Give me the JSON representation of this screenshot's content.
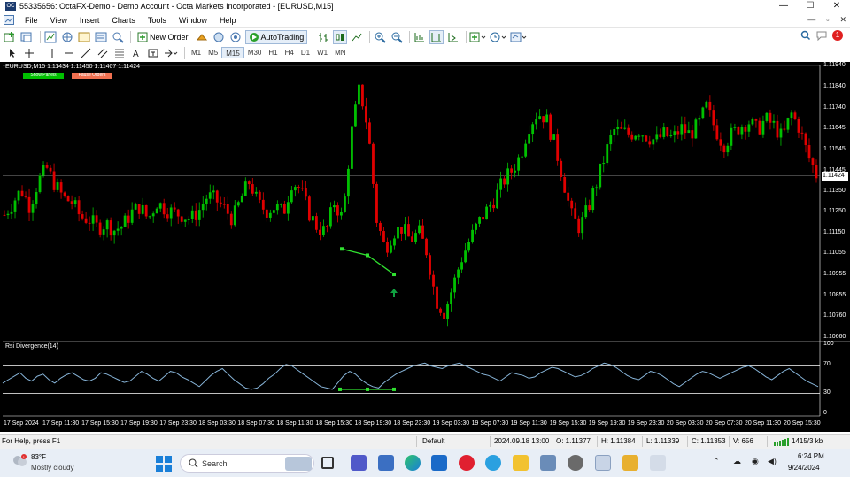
{
  "window": {
    "title": "55335656: OctaFX-Demo - Demo Account - Octa Markets Incorporated - [EURUSD,M15]",
    "minimize": "—",
    "maximize": "☐",
    "close": "✕"
  },
  "menu": {
    "items": [
      "File",
      "View",
      "Insert",
      "Charts",
      "Tools",
      "Window",
      "Help"
    ],
    "right_controls": [
      "—",
      "▫",
      "✕"
    ]
  },
  "toolbar": {
    "new_order": "New Order",
    "auto_trading": "AutoTrading",
    "notification_count": "1"
  },
  "timeframes": [
    "M1",
    "M5",
    "M15",
    "M30",
    "H1",
    "H4",
    "D1",
    "W1",
    "MN"
  ],
  "active_timeframe": "M15",
  "chart": {
    "symbol_info": "EURUSD,M15  1.11434 1.11450 1.11407 1.11424",
    "show_button": "Show Panels",
    "pause_button": "Pause Orders",
    "current_price": "1.11424",
    "indicator_label": "Rsi Divergence(14)",
    "colors": {
      "up": "#00c000",
      "down": "#e00000",
      "rsi_line": "#87b4d8",
      "divergence": "#30e030",
      "background": "#000000"
    }
  },
  "chart_data": {
    "type": "candlestick",
    "symbol": "EURUSD",
    "timeframe": "M15",
    "price_axis_ticks": [
      "1.11940",
      "1.11840",
      "1.11740",
      "1.11645",
      "1.11545",
      "1.11445",
      "1.11350",
      "1.11250",
      "1.11150",
      "1.11055",
      "1.10955",
      "1.10855",
      "1.10760",
      "1.10660"
    ],
    "ylim": [
      1.1066,
      1.1194
    ],
    "current_price": 1.11424,
    "time_labels": [
      "17 Sep 2024",
      "17 Sep 11:30",
      "17 Sep 15:30",
      "17 Sep 19:30",
      "17 Sep 23:30",
      "18 Sep 03:30",
      "18 Sep 07:30",
      "18 Sep 11:30",
      "18 Sep 15:30",
      "18 Sep 19:30",
      "18 Sep 23:30",
      "19 Sep 03:30",
      "19 Sep 07:30",
      "19 Sep 11:30",
      "19 Sep 15:30",
      "19 Sep 19:30",
      "19 Sep 23:30",
      "20 Sep 03:30",
      "20 Sep 07:30",
      "20 Sep 11:30",
      "20 Sep 15:30"
    ],
    "close_path": [
      1.1124,
      1.113,
      1.1136,
      1.1128,
      1.114,
      1.1146,
      1.1138,
      1.1132,
      1.113,
      1.1123,
      1.1122,
      1.1118,
      1.112,
      1.1117,
      1.1119,
      1.1125,
      1.1128,
      1.1122,
      1.113,
      1.1127,
      1.1125,
      1.1124,
      1.1122,
      1.1126,
      1.1133,
      1.1131,
      1.1127,
      1.1122,
      1.1132,
      1.114,
      1.1129,
      1.1126,
      1.1128,
      1.1125,
      1.114,
      1.1136,
      1.1125,
      1.1118,
      1.1116,
      1.113,
      1.1122,
      1.1162,
      1.1184,
      1.1164,
      1.1122,
      1.1108,
      1.1116,
      1.1118,
      1.1112,
      1.1116,
      1.1106,
      1.1084,
      1.1078,
      1.109,
      1.1103,
      1.1112,
      1.112,
      1.1126,
      1.1132,
      1.114,
      1.1145,
      1.1152,
      1.1166,
      1.1172,
      1.117,
      1.1158,
      1.1142,
      1.1124,
      1.1118,
      1.1127,
      1.1139,
      1.1152,
      1.1164,
      1.1163,
      1.1162,
      1.1164,
      1.1161,
      1.1159,
      1.1162,
      1.116,
      1.1165,
      1.1162,
      1.1166,
      1.1175,
      1.1165,
      1.1157,
      1.1162,
      1.1166,
      1.1168,
      1.1164,
      1.1169,
      1.1166,
      1.116,
      1.1172,
      1.1165,
      1.1152,
      1.1143
    ],
    "divergence_line": {
      "price_points": [
        1.1108,
        1.1105,
        1.1096
      ]
    },
    "signal_arrow": "up",
    "rsi": {
      "name": "Rsi Divergence(14)",
      "levels": [
        70,
        30
      ],
      "axis_ticks": [
        "100",
        "70",
        "30",
        "0"
      ],
      "values": [
        45,
        50,
        55,
        60,
        52,
        48,
        55,
        58,
        50,
        45,
        52,
        57,
        60,
        55,
        50,
        48,
        52,
        60,
        58,
        54,
        50,
        46,
        48,
        55,
        62,
        58,
        52,
        48,
        55,
        62,
        60,
        54,
        50,
        45,
        40,
        48,
        56,
        62,
        66,
        58,
        50,
        44,
        38,
        36,
        38,
        44,
        52,
        58,
        66,
        72,
        70,
        64,
        58,
        52,
        46,
        40,
        38,
        36,
        46,
        56,
        62,
        58,
        50,
        44,
        40,
        38,
        46,
        52,
        58,
        62,
        66,
        70,
        72,
        74,
        70,
        68,
        66,
        70,
        72,
        74,
        70,
        66,
        62,
        58,
        56,
        52,
        48,
        54,
        60,
        58,
        56,
        52,
        54,
        60,
        64,
        68,
        66,
        62,
        58,
        54,
        56,
        60,
        66,
        70,
        74,
        72,
        68,
        62,
        56,
        52,
        50,
        56,
        62,
        60,
        56,
        50,
        44,
        40,
        46,
        52,
        58,
        62,
        60,
        56,
        52,
        56,
        60,
        64,
        68,
        70,
        66,
        60,
        54,
        50,
        56,
        62,
        66,
        60,
        54,
        48,
        44,
        40
      ]
    }
  },
  "status": {
    "help": "For Help, press F1",
    "profile": "Default",
    "datetime": "2024.09.18 13:00",
    "open": "O: 1.11377",
    "high": "H: 1.11384",
    "low": "L: 1.11339",
    "close": "C: 1.11353",
    "volume": "V: 656",
    "traffic": "1415/3 kb"
  },
  "taskbar": {
    "weather_temp": "83°F",
    "weather_desc": "Mostly cloudy",
    "search_label": "Search",
    "time": "6:24 PM",
    "date": "9/24/2024"
  }
}
